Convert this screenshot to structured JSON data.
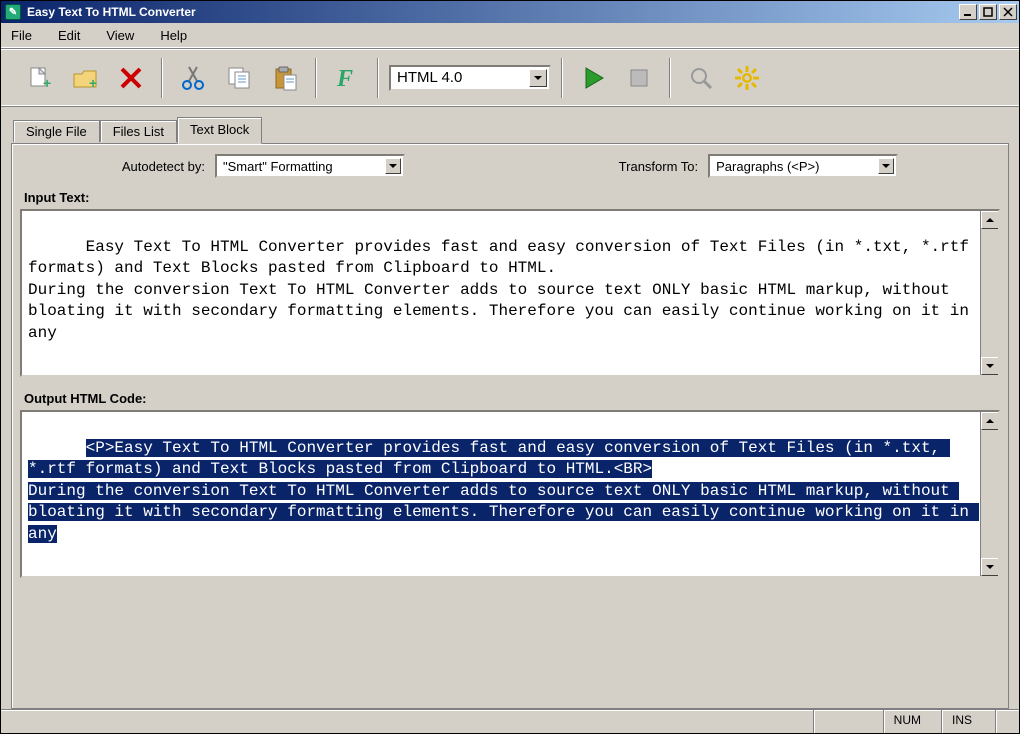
{
  "window": {
    "title": "Easy Text To HTML Converter"
  },
  "menu": {
    "items": [
      "File",
      "Edit",
      "View",
      "Help"
    ]
  },
  "toolbar": {
    "format_selected": "HTML 4.0"
  },
  "tabs": {
    "items": [
      "Single File",
      "Files List",
      "Text Block"
    ],
    "active_index": 2
  },
  "options": {
    "autodetect_label": "Autodetect by:",
    "autodetect_value": "\"Smart\" Formatting",
    "transform_label": "Transform To:",
    "transform_value": "Paragraphs (<P>)"
  },
  "input": {
    "label": "Input Text:",
    "text": "Easy Text To HTML Converter provides fast and easy conversion of Text Files (in *.txt, *.rtf formats) and Text Blocks pasted from Clipboard to HTML.\nDuring the conversion Text To HTML Converter adds to source text ONLY basic HTML markup, without bloating it with secondary formatting elements. Therefore you can easily continue working on it in any"
  },
  "output": {
    "label": "Output HTML Code:",
    "selected_part": "<P>Easy Text To HTML Converter provides fast and easy conversion of Text Files (in *.txt, *.rtf formats) and Text Blocks pasted from Clipboard to HTML.<BR>",
    "rest_part": "During the conversion Text To HTML Converter adds to source text ONLY basic HTML markup, without bloating it with secondary formatting elements. Therefore you can easily continue working on it in any"
  },
  "status": {
    "num": "NUM",
    "ins": "INS"
  }
}
